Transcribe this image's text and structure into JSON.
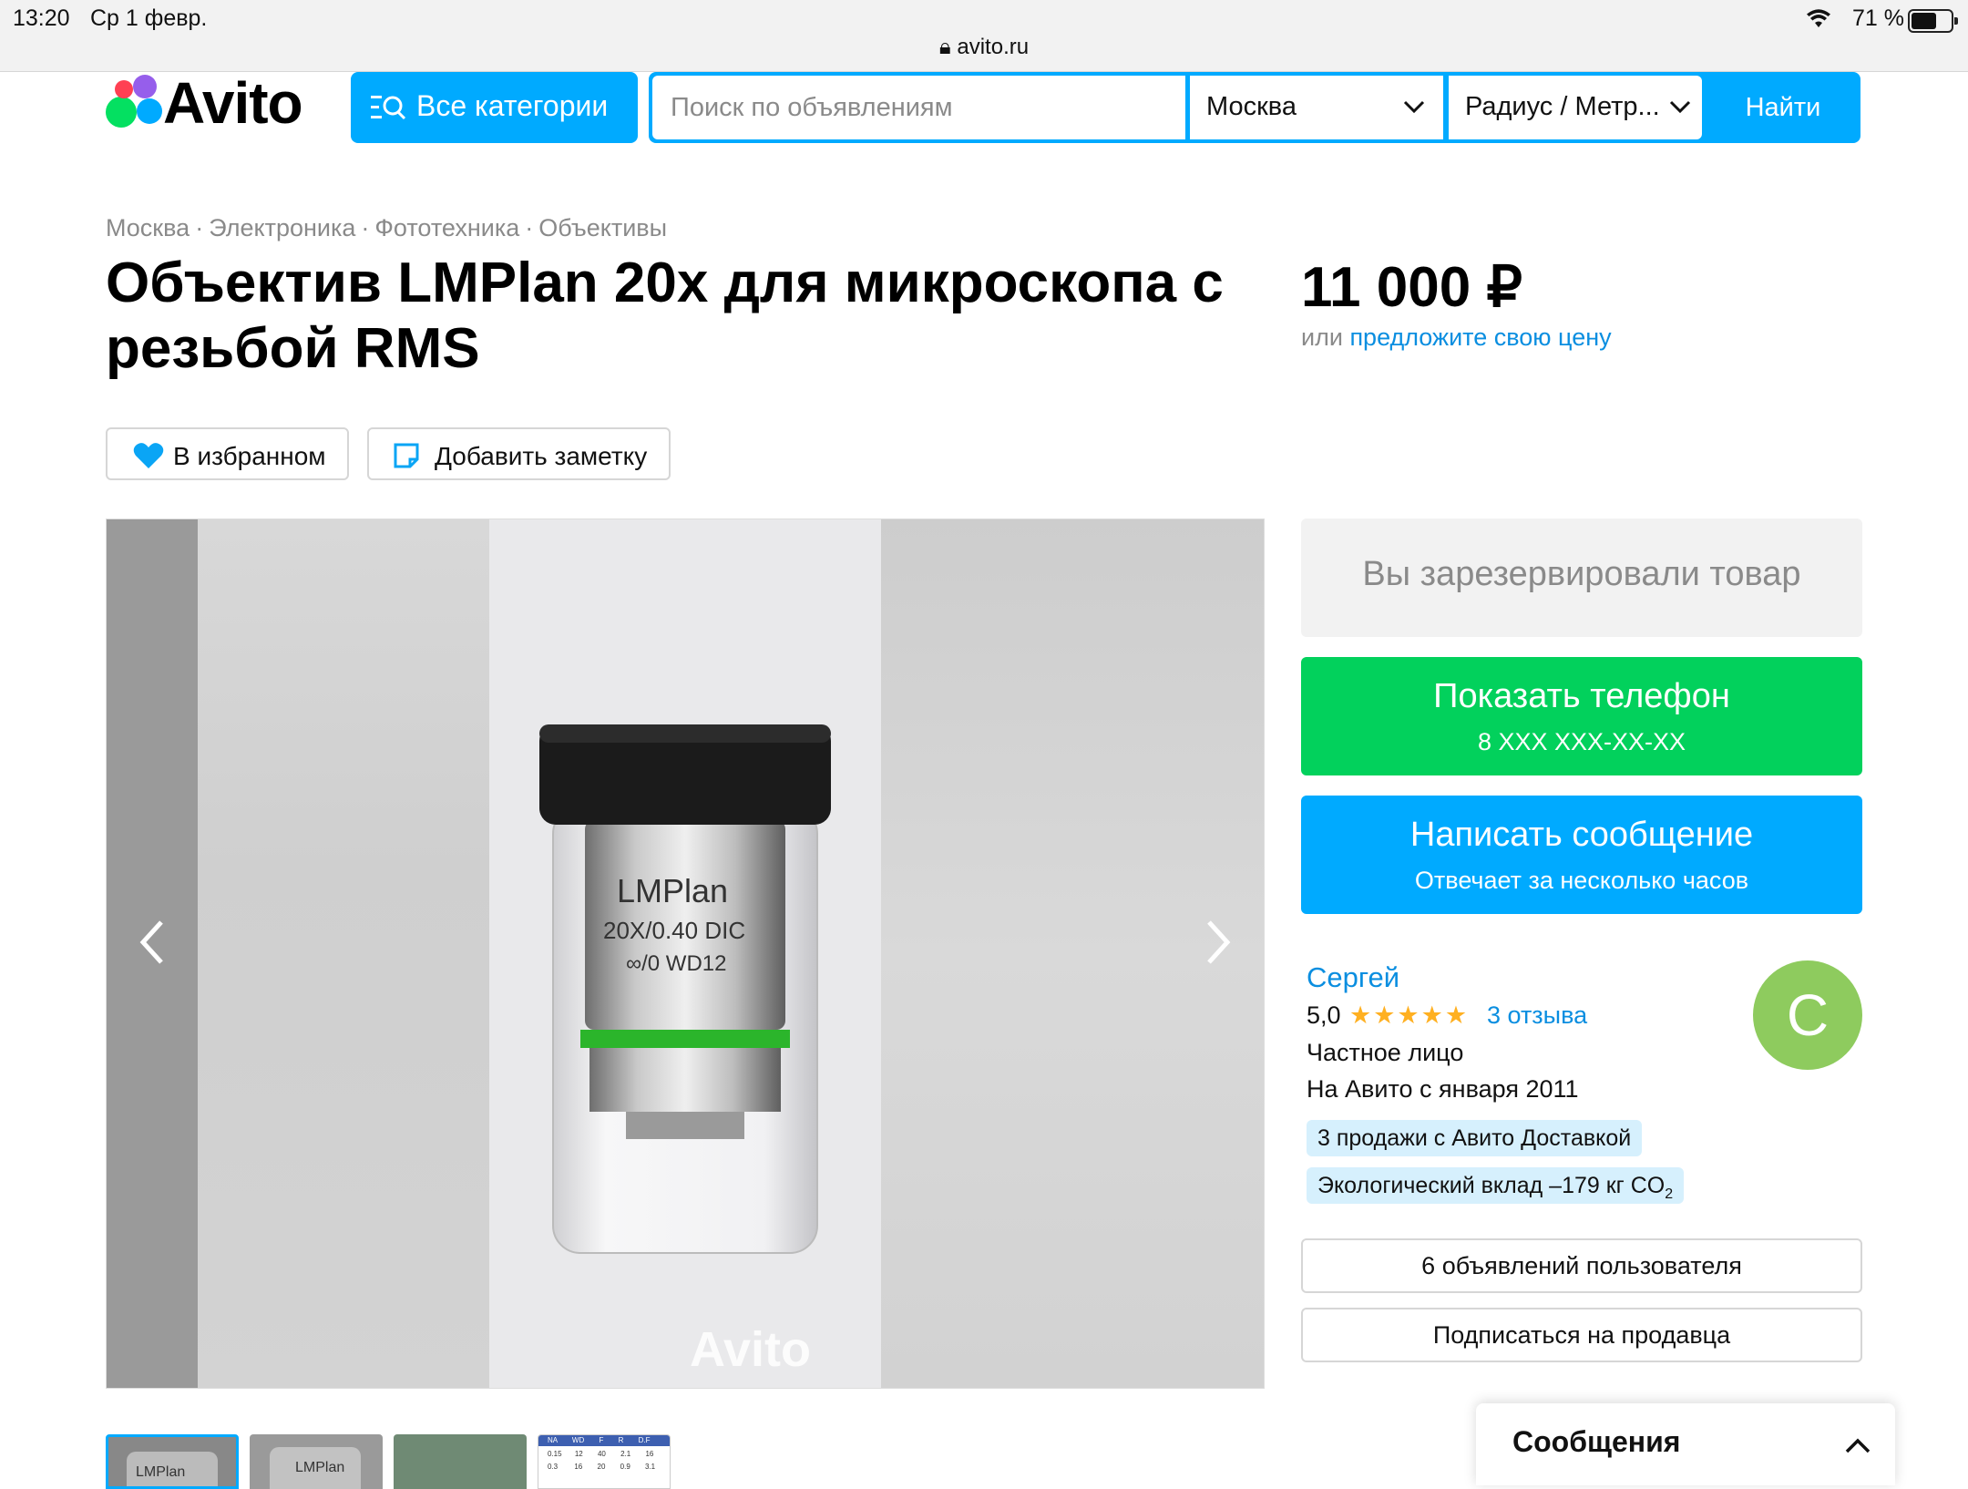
{
  "status_bar": {
    "time": "13:20",
    "date": "Ср 1 февр.",
    "url": "avito.ru",
    "battery": "71 %",
    "battery_level": 0.71
  },
  "header": {
    "logo_text": "Avito",
    "categories_label": "Все категории",
    "search_placeholder": "Поиск по объявлениям",
    "city_value": "Москва",
    "radius_value": "Радиус / Метр...",
    "search_button": "Найти"
  },
  "breadcrumbs": [
    "Москва",
    "Электроника",
    "Фототехника",
    "Объективы"
  ],
  "listing": {
    "title": "Объектив LMPlan 20x для микроскопа с резьбой RMS",
    "price": "11 000 ₽",
    "price_sub_prefix": "или",
    "price_sub_link": "предложите свою цену",
    "favorite_label": "В избранном",
    "note_label": "Добавить заметку"
  },
  "gallery": {
    "lens_text_1": "LMPlan",
    "lens_text_2": "20X/0.40 DIC",
    "lens_text_3": "∞/0 WD12",
    "watermark": "Avito",
    "thumb_label": "LMPlan",
    "table_headers": [
      "NA",
      "WD",
      "F",
      "R",
      "D.F"
    ],
    "table_row_1": [
      "0.15",
      "12",
      "40",
      "2.1",
      "16"
    ],
    "table_row_2": [
      "0.3",
      "16",
      "20",
      "0.9",
      "3.1"
    ]
  },
  "actions": {
    "reserved": "Вы зарезервировали товар",
    "show_phone": "Показать телефон",
    "phone_masked": "8 XXX XXX-XX-XX",
    "write_message": "Написать сообщение",
    "reply_time": "Отвечает за несколько часов"
  },
  "seller": {
    "name": "Сергей",
    "rating": "5,0",
    "stars": "★★★★★",
    "reviews": "3 отзыва",
    "type": "Частное лицо",
    "since": "На Авито с января 2011",
    "avatar_letter": "С",
    "badge_delivery": "3 продажи с Авито Доставкой",
    "badge_eco": "Экологический вклад –179 кг CO",
    "badge_eco_sub": "2",
    "listings_button": "6 объявлений пользователя",
    "subscribe_button": "Подписаться на продавца"
  },
  "messages_panel": {
    "label": "Сообщения"
  },
  "colors": {
    "brand_blue": "#00aaff",
    "green": "#02d15c",
    "link": "#0a8ee0",
    "star": "#ffb021"
  }
}
